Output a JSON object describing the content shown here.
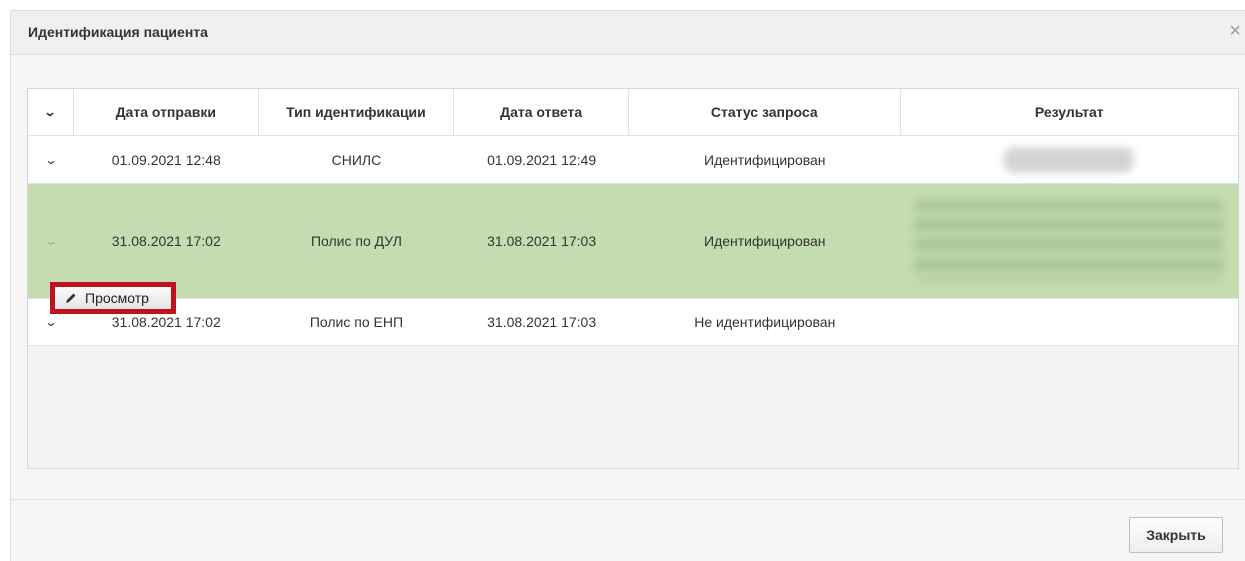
{
  "dialog": {
    "title": "Идентификация пациента",
    "close_icon": "×",
    "close_button": "Закрыть"
  },
  "table": {
    "expand_all_icon": "chevron-down-icon",
    "columns": [
      "Дата отправки",
      "Тип идентификации",
      "Дата ответа",
      "Статус запроса",
      "Результат"
    ],
    "rows": [
      {
        "sent": "01.09.2021 12:48",
        "type": "СНИЛС",
        "answered": "01.09.2021 12:49",
        "status": "Идентифицирован",
        "result_obscured": true,
        "selected": false
      },
      {
        "sent": "31.08.2021 17:02",
        "type": "Полис по ДУЛ",
        "answered": "31.08.2021 17:03",
        "status": "Идентифицирован",
        "result_obscured": true,
        "selected": true
      },
      {
        "sent": "31.08.2021 17:02",
        "type": "Полис по ЕНП",
        "answered": "31.08.2021 17:03",
        "status": "Не идентифицирован",
        "result_obscured": false,
        "selected": false
      }
    ],
    "row_action": {
      "label": "Просмотр",
      "icon": "pencil-icon"
    }
  },
  "colors": {
    "selected_row": "#c5dcb0",
    "highlight": "#c0111d"
  }
}
